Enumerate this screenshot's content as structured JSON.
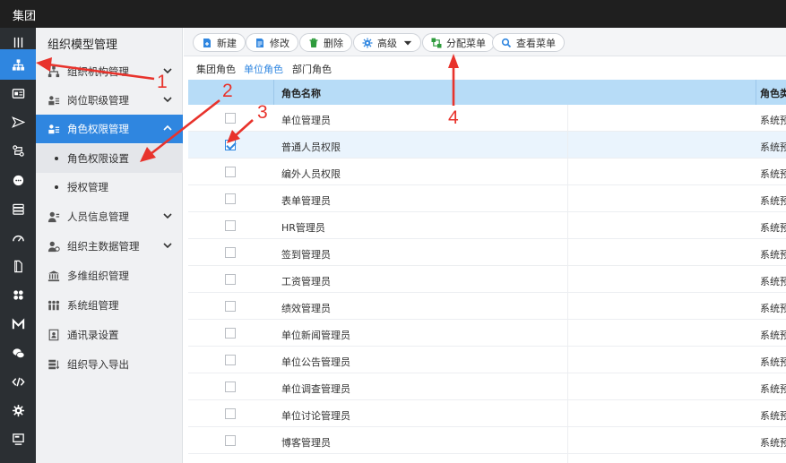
{
  "app": {
    "title": "集团"
  },
  "sidebar": {
    "title": "组织模型管理",
    "items": [
      {
        "label": "组织机构管理",
        "icon": "org-chart-icon"
      },
      {
        "label": "岗位职级管理",
        "icon": "position-icon"
      },
      {
        "label": "角色权限管理",
        "icon": "role-permission-icon"
      },
      {
        "label": "角色权限设置"
      },
      {
        "label": "授权管理"
      },
      {
        "label": "人员信息管理",
        "icon": "person-info-icon"
      },
      {
        "label": "组织主数据管理",
        "icon": "master-data-icon"
      },
      {
        "label": "多维组织管理",
        "icon": "bank-icon"
      },
      {
        "label": "系统组管理",
        "icon": "group-icon"
      },
      {
        "label": "通讯录设置",
        "icon": "contacts-icon"
      },
      {
        "label": "组织导入导出",
        "icon": "import-export-icon"
      }
    ]
  },
  "toolbar": {
    "new": "新建",
    "edit": "修改",
    "delete": "删除",
    "advanced": "高级",
    "assign_menu": "分配菜单",
    "view_menu": "查看菜单"
  },
  "tabs": [
    "集团角色",
    "单位角色",
    "部门角色"
  ],
  "table": {
    "headers": [
      "角色名称",
      "角色类"
    ],
    "rows": [
      {
        "name": "单位管理员",
        "type": "系统预",
        "checked": false
      },
      {
        "name": "普通人员权限",
        "type": "系统预",
        "checked": true
      },
      {
        "name": "编外人员权限",
        "type": "系统预",
        "checked": false
      },
      {
        "name": "表单管理员",
        "type": "系统预",
        "checked": false
      },
      {
        "name": "HR管理员",
        "type": "系统预",
        "checked": false
      },
      {
        "name": "签到管理员",
        "type": "系统预",
        "checked": false
      },
      {
        "name": "工资管理员",
        "type": "系统预",
        "checked": false
      },
      {
        "name": "绩效管理员",
        "type": "系统预",
        "checked": false
      },
      {
        "name": "单位新闻管理员",
        "type": "系统预",
        "checked": false
      },
      {
        "name": "单位公告管理员",
        "type": "系统预",
        "checked": false
      },
      {
        "name": "单位调查管理员",
        "type": "系统预",
        "checked": false
      },
      {
        "name": "单位讨论管理员",
        "type": "系统预",
        "checked": false
      },
      {
        "name": "博客管理员",
        "type": "系统预",
        "checked": false
      }
    ]
  },
  "annotations": [
    "1",
    "2",
    "3",
    "4"
  ],
  "colors": {
    "accent": "#2f86e0",
    "annotation": "#e8332c",
    "header_bg": "#b7dcf7"
  }
}
